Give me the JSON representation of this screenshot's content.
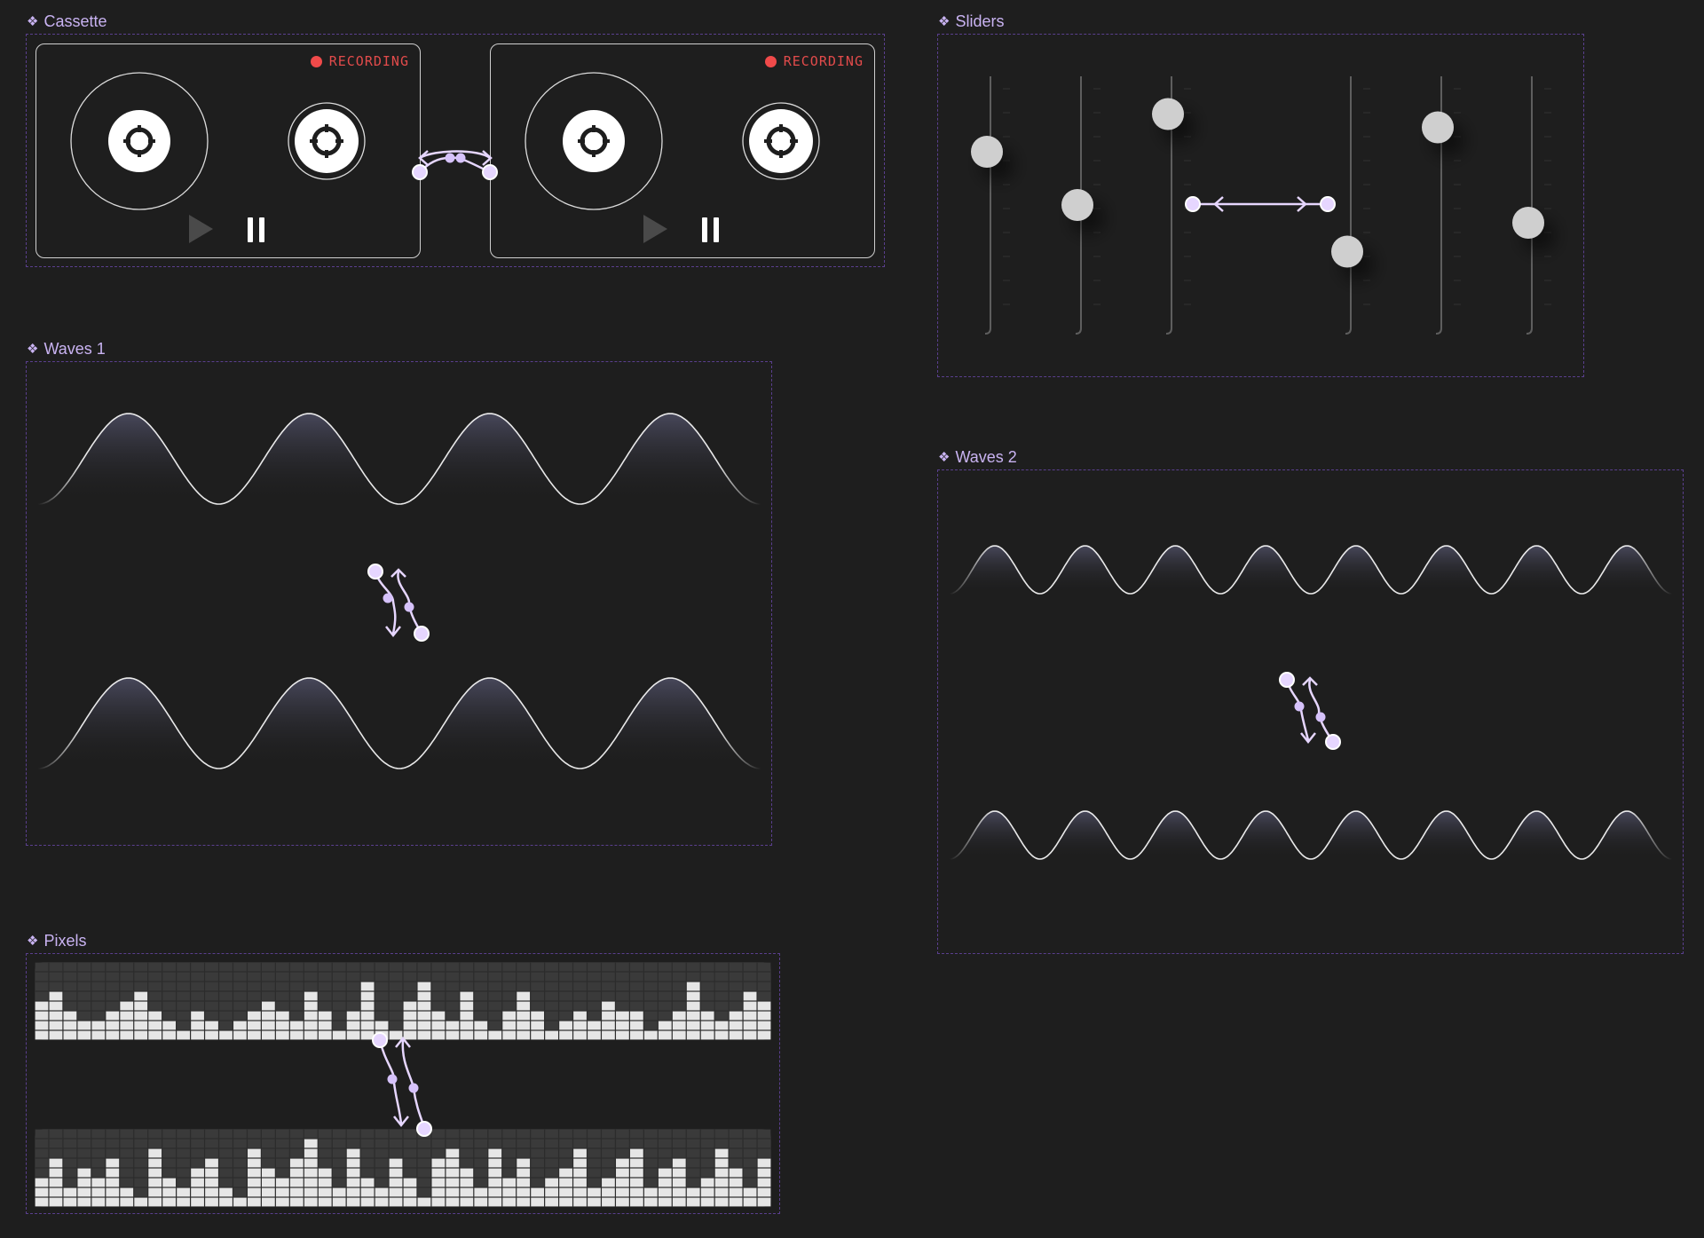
{
  "colors": {
    "background": "#1e1e1e",
    "label": "#c9b3f2",
    "frame_border": "#5a3f8e",
    "recording_red": "#f04a4a",
    "connector": "#e6d6ff",
    "knob": "#cfcfcf",
    "pixel_on": "#e6e6e6",
    "pixel_off": "#3a3a3a"
  },
  "frames": {
    "cassette": {
      "label": "Cassette",
      "icon": "component-icon"
    },
    "sliders": {
      "label": "Sliders",
      "icon": "component-icon"
    },
    "waves1": {
      "label": "Waves 1",
      "icon": "component-icon"
    },
    "waves2": {
      "label": "Waves 2",
      "icon": "component-icon"
    },
    "pixels": {
      "label": "Pixels",
      "icon": "component-icon"
    }
  },
  "cassette": {
    "decks": [
      {
        "status": "RECORDING",
        "controls": [
          "play-icon",
          "pause-icon"
        ]
      },
      {
        "status": "RECORDING",
        "controls": [
          "play-icon",
          "pause-icon"
        ]
      }
    ]
  },
  "sliders": {
    "levels": [
      0.74,
      0.5,
      0.91,
      0.29,
      0.85,
      0.42
    ]
  },
  "waves1": {
    "rows": 2,
    "cycles": 4
  },
  "waves2": {
    "rows": 2,
    "cycles": 8
  },
  "pixels": {
    "columns": 52,
    "max_level": 8,
    "top_levels": [
      4,
      5,
      3,
      2,
      2,
      3,
      4,
      5,
      3,
      2,
      1,
      3,
      2,
      1,
      2,
      3,
      4,
      3,
      2,
      5,
      3,
      1,
      3,
      6,
      2,
      1,
      4,
      6,
      3,
      2,
      5,
      2,
      1,
      3,
      5,
      3,
      1,
      2,
      3,
      2,
      4,
      3,
      3,
      1,
      2,
      3,
      6,
      3,
      2,
      3,
      5,
      4
    ],
    "bottom_levels": [
      3,
      5,
      2,
      4,
      3,
      5,
      2,
      1,
      6,
      3,
      2,
      4,
      5,
      2,
      1,
      6,
      4,
      3,
      5,
      7,
      4,
      2,
      6,
      3,
      2,
      5,
      3,
      1,
      5,
      6,
      4,
      2,
      6,
      3,
      5,
      2,
      3,
      4,
      6,
      2,
      3,
      5,
      6,
      2,
      4,
      5,
      2,
      3,
      6,
      4,
      2,
      5
    ]
  }
}
